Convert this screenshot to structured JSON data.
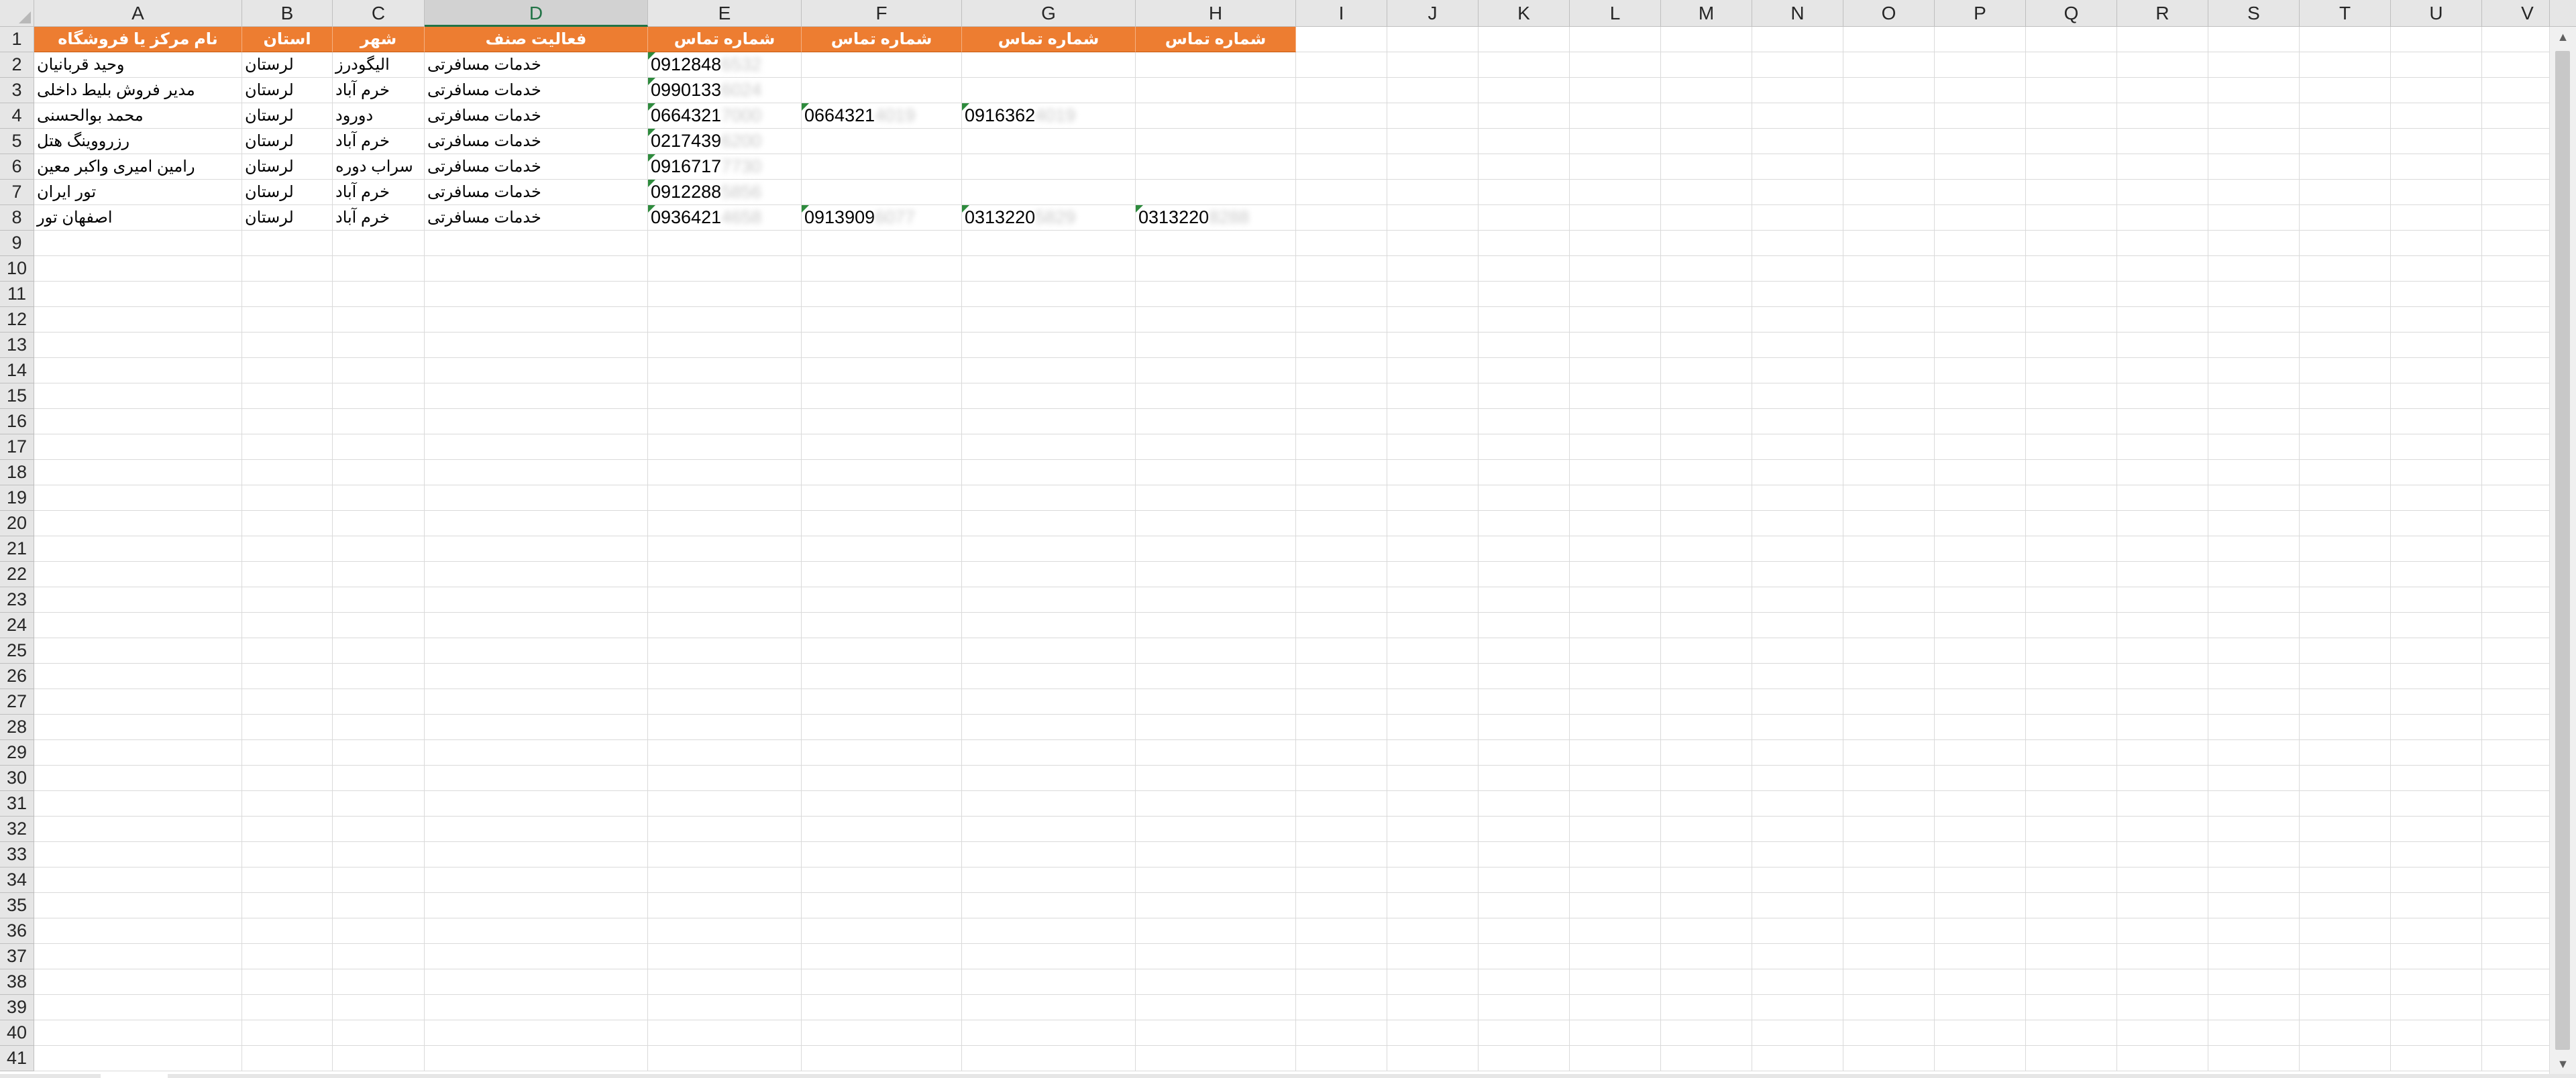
{
  "columns": [
    "A",
    "B",
    "C",
    "D",
    "E",
    "F",
    "G",
    "H",
    "I",
    "J",
    "K",
    "L",
    "M",
    "N",
    "O",
    "P",
    "Q",
    "R",
    "S",
    "T",
    "U",
    "V"
  ],
  "selected_column": "D",
  "row_count": 41,
  "header_row": {
    "A": "نام مرکز یا فروشگاه",
    "B": "استان",
    "C": "شهر",
    "D": "فعالیت صنف",
    "E": "شماره تماس",
    "F": "شماره تماس",
    "G": "شماره تماس",
    "H": "شماره تماس"
  },
  "rows": [
    {
      "A": "وحید قربانیان",
      "B": "لرستان",
      "C": "الیگودرز",
      "D": "خدمات مسافرتی",
      "E": {
        "v": "0912848",
        "h": "6532"
      }
    },
    {
      "A": "مدیر فروش بلیط داخلی",
      "B": "لرستان",
      "C": "خرم آباد",
      "D": "خدمات مسافرتی",
      "E": {
        "v": "0990133",
        "h": "6024"
      }
    },
    {
      "A": "محمد بوالحسنی",
      "B": "لرستان",
      "C": "دورود",
      "D": "خدمات مسافرتی",
      "E": {
        "v": "0664321",
        "h": "7000"
      },
      "F": {
        "v": "0664321",
        "h": "4019"
      },
      "G": {
        "v": "0916362",
        "h": "4019"
      }
    },
    {
      "A": "رزرووینگ هتل",
      "B": "لرستان",
      "C": "خرم آباد",
      "D": "خدمات مسافرتی",
      "E": {
        "v": "0217439",
        "h": "6200"
      }
    },
    {
      "A": "رامین امیری واکبر معین",
      "B": "لرستان",
      "C": "سراب دوره",
      "D": "خدمات مسافرتی",
      "E": {
        "v": "0916717",
        "h": "7730"
      }
    },
    {
      "A": "تور ایران",
      "B": "لرستان",
      "C": "خرم آباد",
      "D": "خدمات مسافرتی",
      "E": {
        "v": "0912288",
        "h": "5856"
      }
    },
    {
      "A": "اصفهان تور",
      "B": "لرستان",
      "C": "خرم آباد",
      "D": "خدمات مسافرتی",
      "E": {
        "v": "0936421",
        "h": "4658"
      },
      "F": {
        "v": "0913909",
        "h": "6077"
      },
      "G": {
        "v": "0313220",
        "h": "5829"
      },
      "H": {
        "v": "0313220",
        "h": "8288"
      }
    }
  ],
  "colors": {
    "header_fill": "#ed7d31",
    "header_text": "#ffffff",
    "selection_accent": "#217346",
    "error_triangle": "#2e8b3d"
  },
  "icons": {
    "scroll_up": "scroll-up-arrow-icon",
    "scroll_down": "scroll-down-arrow-icon",
    "select_all": "select-all-triangle-icon"
  }
}
